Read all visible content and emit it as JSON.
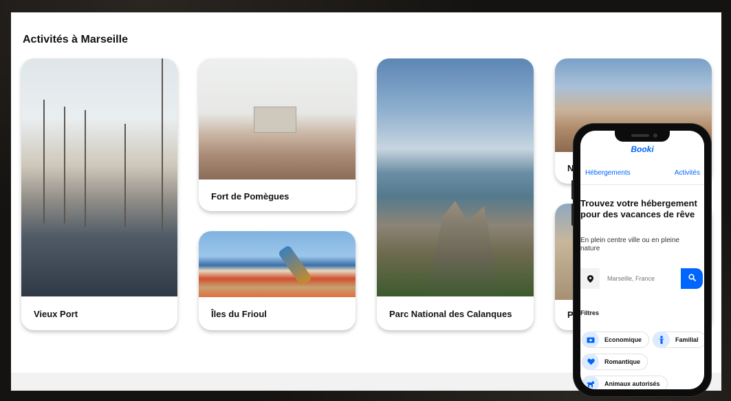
{
  "section": {
    "title": "Activités à Marseille"
  },
  "cards": [
    {
      "label": "Vieux Port"
    },
    {
      "label": "Fort de Pomègues"
    },
    {
      "label": "Îles du Frioul"
    },
    {
      "label": "Parc National des Calanques"
    },
    {
      "label": "N"
    },
    {
      "label": "Pa"
    }
  ],
  "phone": {
    "logo": "Booki",
    "nav": {
      "left": "Hébergements",
      "right": "Activités"
    },
    "hero": {
      "title": "Trouvez votre hébergement pour des vacances de rêve",
      "subtitle": "En plein centre ville ou en pleine nature"
    },
    "search": {
      "placeholder": "Marseille, France",
      "location_icon": "map-pin-icon",
      "button_icon": "search-icon"
    },
    "filters": {
      "title": "Filtres",
      "chips": [
        {
          "label": "Economique",
          "icon": "money-icon"
        },
        {
          "label": "Familial",
          "icon": "person-icon"
        },
        {
          "label": "Romantique",
          "icon": "heart-icon"
        },
        {
          "label": "Animaux autorisés",
          "icon": "dog-icon"
        }
      ]
    }
  },
  "colors": {
    "accent": "#0065fc",
    "chip_bg": "#deebff"
  }
}
